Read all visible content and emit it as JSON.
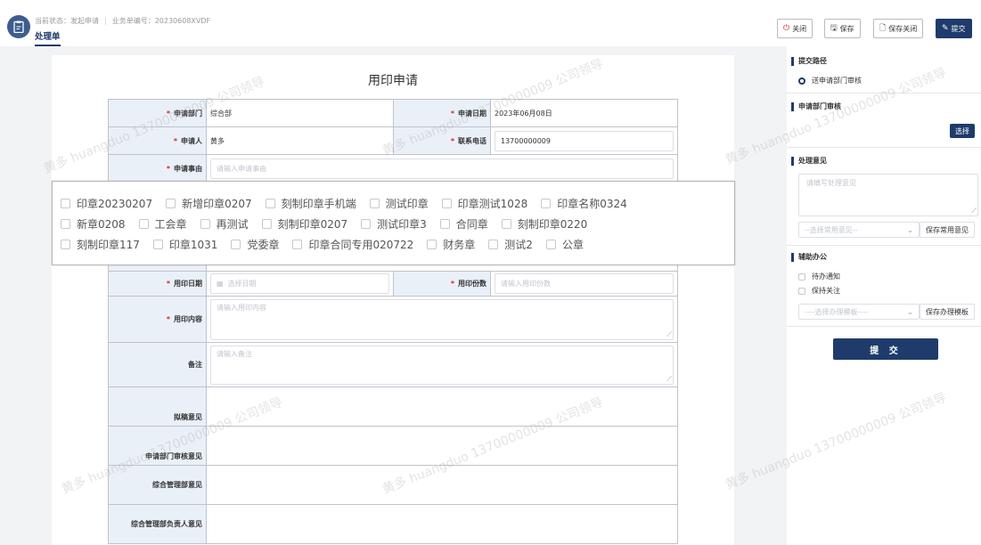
{
  "header": {
    "status_label": "当前状态：发起申请",
    "business_no": "业务单编号：20230608XVDF",
    "tab": "处理单"
  },
  "toolbar": {
    "close": "关闭",
    "save": "保存",
    "save_close": "保存关闭",
    "submit": "提交"
  },
  "form": {
    "title": "用印申请",
    "dept_label": "申请部门",
    "dept_value": "综合部",
    "date_label": "申请日期",
    "date_value": "2023年06月08日",
    "applicant_label": "申请人",
    "applicant_value": "黄多",
    "phone_label": "联系电话",
    "phone_value": "13700000009",
    "reason_label": "申请事由",
    "reason_placeholder": "请输入申请事由",
    "use_date_label": "用印日期",
    "use_date_placeholder": "选择日期",
    "copies_label": "用印份数",
    "copies_placeholder": "请输入用印份数",
    "content_label": "用印内容",
    "content_placeholder": "请输入用印内容",
    "note_label": "备注",
    "note_placeholder": "请输入备注",
    "draft_label": "拟稿意见",
    "dept_review_label": "申请部门审核意见",
    "mgmt_label": "综合管理部意见",
    "mgmt_head_label": "综合管理部负责人意见"
  },
  "seals": [
    [
      "印章20230207",
      "新增印章0207",
      "刻制印章手机端",
      "测试印章",
      "印章测试1028",
      "印章名称0324"
    ],
    [
      "新章0208",
      "工会章",
      "再测试",
      "刻制印章0207",
      "测试印章3",
      "合同章",
      "刻制印章0220"
    ],
    [
      "刻制印章117",
      "印章1031",
      "党委章",
      "印章合同专用020722",
      "财务章",
      "测试2",
      "公章"
    ]
  ],
  "side": {
    "route_title": "提交路径",
    "route_option": "送申请部门审核",
    "dept_review_title": "申请部门审核",
    "choose": "选择",
    "opinion_title": "处理意见",
    "opinion_placeholder": "请填写处理意见",
    "common_select": "--选择常用意见--",
    "save_common": "保存常用意见",
    "assist_title": "辅助办公",
    "todo_notice": "待办通知",
    "keep_follow": "保持关注",
    "template_select": "----选择办理模板----",
    "save_template": "保存办理模板",
    "submit_big": "提 交"
  },
  "watermark": "黄多 huangduo 13700000009 公司领导"
}
